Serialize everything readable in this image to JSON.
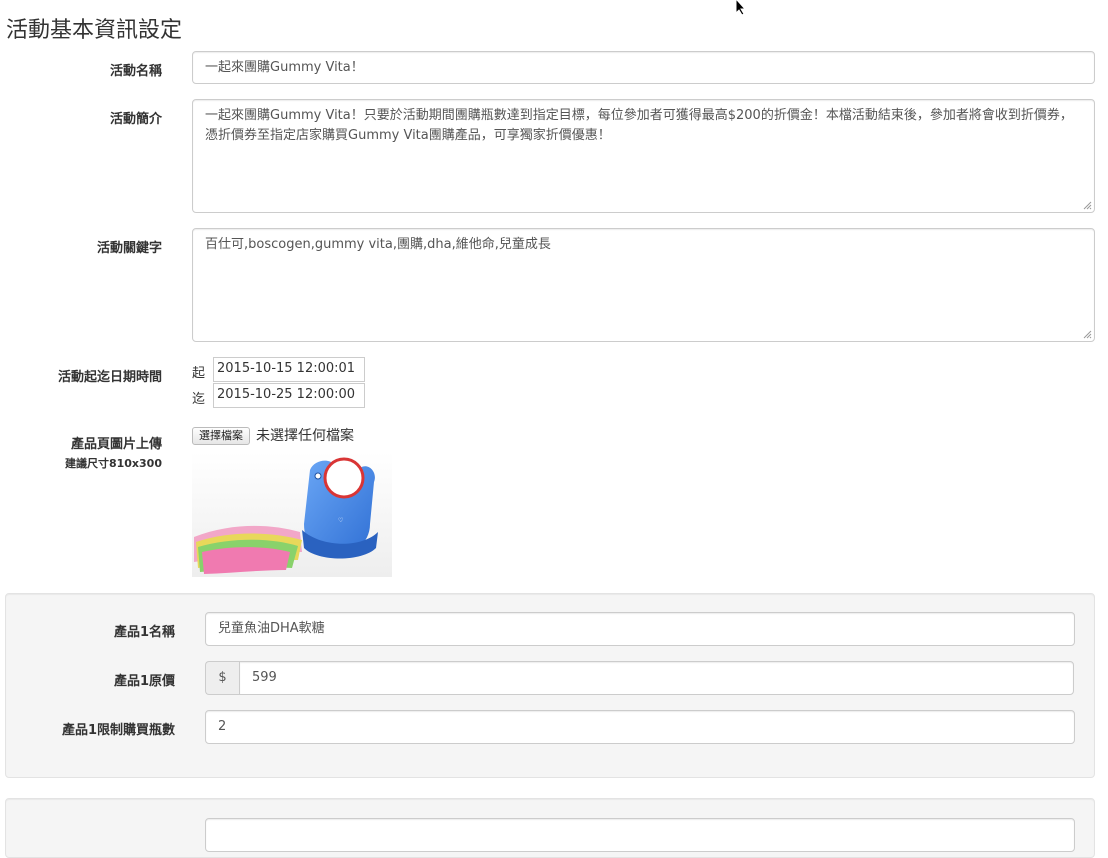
{
  "page": {
    "title": "活動基本資訊設定"
  },
  "form": {
    "name_label": "活動名稱",
    "name_value": "一起來團購Gummy Vita！",
    "intro_label": "活動簡介",
    "intro_value": "一起來團購Gummy Vita！只要於活動期間團購瓶數達到指定目標，每位參加者可獲得最高$200的折價金！本檔活動結束後，參加者將會收到折價券，憑折價券至指定店家購買Gummy Vita團購產品，可享獨家折價優惠！",
    "keywords_label": "活動關鍵字",
    "keywords_value": "百仕可,boscogen,gummy vita,團購,dha,維他命,兒童成長",
    "dates_label": "活動起迄日期時間",
    "start_prefix": "起",
    "start_value": "2015-10-15 12:00:01",
    "end_prefix": "迄",
    "end_value": "2015-10-25 12:00:00",
    "upload_label": "產品頁圖片上傳",
    "upload_hint": "建議尺寸810x300",
    "file_button": "選擇檔案",
    "file_status": "未選擇任何檔案"
  },
  "products": [
    {
      "name_label": "產品1名稱",
      "name_value": "兒童魚油DHA軟糖",
      "price_label": "產品1原價",
      "currency": "$",
      "price_value": "599",
      "limit_label": "產品1限制購買瓶數",
      "limit_value": "2"
    }
  ],
  "icons": {
    "cursor": "mouse-pointer-icon",
    "resize": "resize-grip-icon",
    "image": "product-image-bib"
  },
  "colors": {
    "border": "#cccccc",
    "well_bg": "#f5f5f5",
    "bib_blue": "#3d7fe0",
    "bib_ring": "#e03a3a"
  }
}
